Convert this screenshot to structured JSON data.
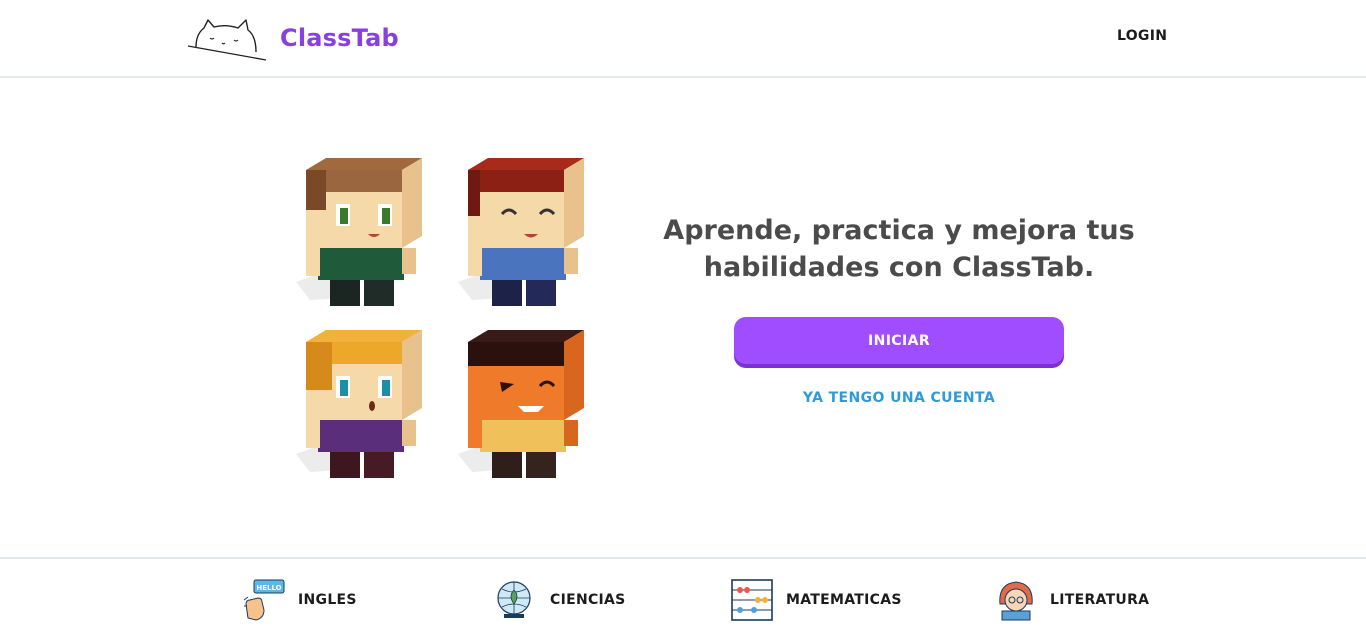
{
  "header": {
    "brand": "ClassTab",
    "login_label": "LOGIN"
  },
  "hero": {
    "headline": "Aprende, practica y mejora tus habilidades con ClassTab.",
    "start_label": "INICIAR",
    "account_label": "YA TENGO UNA CUENTA",
    "illustration_icon": "four-voxel-characters"
  },
  "subjects": [
    {
      "label": "INGLES",
      "icon": "hello-hand-icon"
    },
    {
      "label": "CIENCIAS",
      "icon": "science-globe-icon"
    },
    {
      "label": "MATEMATICAS",
      "icon": "abacus-icon"
    },
    {
      "label": "LITERATURA",
      "icon": "reader-girl-icon"
    }
  ],
  "colors": {
    "brand": "#8a3fe0",
    "primary_button": "#a04cff",
    "link": "#2e9bd8",
    "headline": "#4b4b4b"
  }
}
